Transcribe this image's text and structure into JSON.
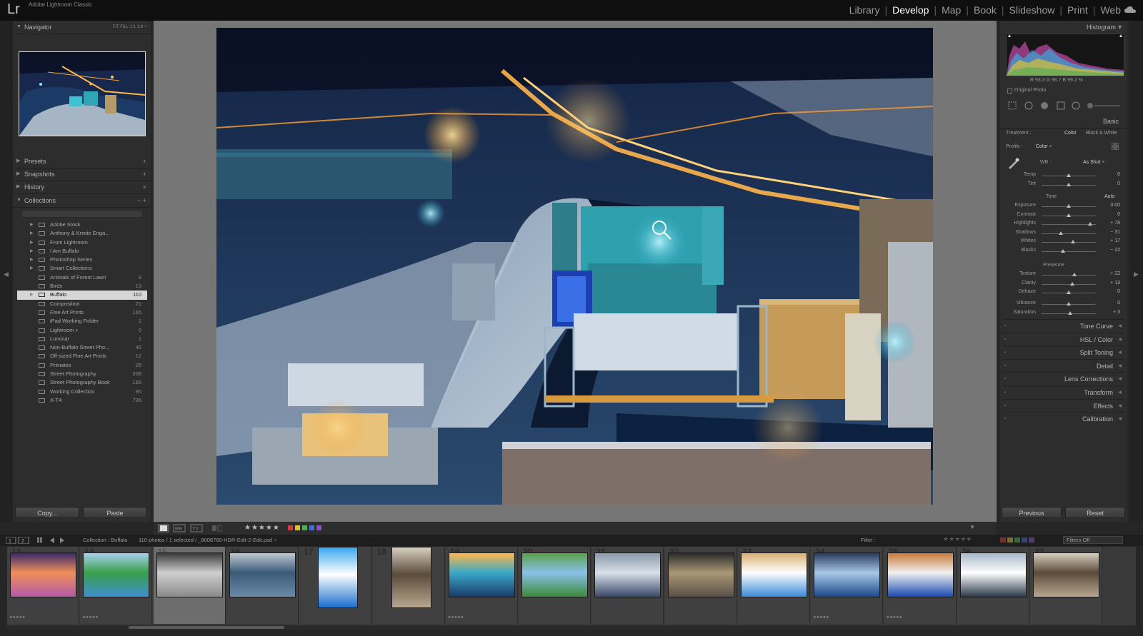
{
  "app": {
    "logo": "Lr",
    "title": "Adobe Lightroom Classic"
  },
  "modules": [
    {
      "label": "Library",
      "active": false
    },
    {
      "label": "Develop",
      "active": true
    },
    {
      "label": "Map",
      "active": false
    },
    {
      "label": "Book",
      "active": false
    },
    {
      "label": "Slideshow",
      "active": false
    },
    {
      "label": "Print",
      "active": false
    },
    {
      "label": "Web",
      "active": false
    }
  ],
  "left_panel": {
    "navigator": {
      "label": "Navigator",
      "controls": "FIT  FILL  1:1  1:8 ÷"
    },
    "presets": {
      "label": "Presets",
      "action": "+"
    },
    "snapshots": {
      "label": "Snapshots",
      "action": "+"
    },
    "history": {
      "label": "History",
      "action": "×"
    },
    "collections": {
      "label": "Collections",
      "action": "−  +"
    },
    "collection_items": [
      {
        "label": "Adobe Stock",
        "count": "",
        "set": true
      },
      {
        "label": "Anthony & Kristie Enga...",
        "count": "",
        "set": true
      },
      {
        "label": "From Lightroom",
        "count": "",
        "set": true
      },
      {
        "label": "I Am Buffalo",
        "count": "",
        "set": true
      },
      {
        "label": "Photoshop Series",
        "count": "",
        "set": true
      },
      {
        "label": "Smart Collections",
        "count": "",
        "set": true
      },
      {
        "label": "Animals of Forest Lawn",
        "count": "9",
        "set": false
      },
      {
        "label": "Birds",
        "count": "13",
        "set": false
      },
      {
        "label": "Buffalo",
        "count": "110",
        "set": true,
        "selected": true
      },
      {
        "label": "Composition",
        "count": "21",
        "set": false
      },
      {
        "label": "Fine Art Prints",
        "count": "165",
        "set": false
      },
      {
        "label": "iPad Working Folder",
        "count": "1",
        "set": false
      },
      {
        "label": "Lightroom +",
        "count": "0",
        "set": false
      },
      {
        "label": "Luminar",
        "count": "1",
        "set": false
      },
      {
        "label": "Non-Buffalo Street Pho...",
        "count": "46",
        "set": false
      },
      {
        "label": "Off-sized Fine Art Prints",
        "count": "12",
        "set": false
      },
      {
        "label": "Primates",
        "count": "26",
        "set": false
      },
      {
        "label": "Street Photography",
        "count": "208",
        "set": false
      },
      {
        "label": "Street Photography Book",
        "count": "165",
        "set": false
      },
      {
        "label": "Working Collection",
        "count": "95",
        "set": false
      },
      {
        "label": "X-T4",
        "count": "735",
        "set": false
      }
    ],
    "copy_button": "Copy...",
    "paste_button": "Paste"
  },
  "toolbar": {
    "stars": "★★★★★",
    "color_labels": [
      "#d33b3b",
      "#d9c237",
      "#4fae4f",
      "#3f6fd0",
      "#8a4fc9"
    ]
  },
  "right_panel": {
    "histogram": {
      "label": "Histogram",
      "rgb": "R  93.3   G  96.7   B  99.2  %",
      "original_photo": "Original Photo"
    },
    "basic": {
      "label": "Basic"
    },
    "treatment": {
      "label": "Treatment :",
      "color": "Color",
      "bw": "Black & White"
    },
    "profile": {
      "label": "Profile :",
      "value": "Color ÷"
    },
    "wb": {
      "label": "WB :",
      "value": "As Shot ÷"
    },
    "wb_sliders": [
      {
        "label": "Temp",
        "value": "0",
        "level": 0.5
      },
      {
        "label": "Tint",
        "value": "0",
        "level": 0.5
      }
    ],
    "tone": {
      "label": "Tone",
      "auto": "Auto"
    },
    "tone_sliders": [
      {
        "label": "Exposure",
        "value": "0.00",
        "level": 0.5
      },
      {
        "label": "Contrast",
        "value": "0",
        "level": 0.5
      },
      {
        "label": "Highlights",
        "value": "+ 78",
        "level": 0.89
      },
      {
        "label": "Shadows",
        "value": "− 31",
        "level": 0.35
      },
      {
        "label": "Whites",
        "value": "+ 17",
        "level": 0.58
      },
      {
        "label": "Blacks",
        "value": "− 22",
        "level": 0.39
      }
    ],
    "presence": {
      "label": "Presence"
    },
    "presence_sliders": [
      {
        "label": "Texture",
        "value": "+ 22",
        "level": 0.61
      },
      {
        "label": "Clarity",
        "value": "+ 13",
        "level": 0.56
      },
      {
        "label": "Dehaze",
        "value": "0",
        "level": 0.5
      },
      {
        "label": "Vibrance",
        "value": "0",
        "level": 0.5
      },
      {
        "label": "Saturation",
        "value": "+ 3",
        "level": 0.52
      }
    ],
    "sections": [
      "Tone Curve",
      "HSL / Color",
      "Split Toning",
      "Detail",
      "Lens Corrections",
      "Transform",
      "Effects",
      "Calibration"
    ],
    "previous_button": "Previous",
    "reset_button": "Reset"
  },
  "filmbar": {
    "collection": "Collection : Buffalo",
    "info": "110 photos / 1 selected / _8008780-HDR-Edit-2-Edit.psd ÷",
    "filter_label": "Filter :",
    "filter_value": "Filters Off"
  },
  "filmstrip": [
    {
      "num": "13",
      "stars": "★★★★★"
    },
    {
      "num": "14",
      "stars": "★★★★★"
    },
    {
      "num": "15",
      "stars": ""
    },
    {
      "num": "16",
      "stars": ""
    },
    {
      "num": "17",
      "stars": ""
    },
    {
      "num": "18",
      "stars": ""
    },
    {
      "num": "19",
      "stars": "★★★★★"
    },
    {
      "num": "20",
      "stars": ""
    },
    {
      "num": "21",
      "stars": ""
    },
    {
      "num": "22",
      "stars": ""
    },
    {
      "num": "23",
      "stars": ""
    },
    {
      "num": "24",
      "stars": "★★★★★"
    },
    {
      "num": "25",
      "stars": "★★★★★"
    },
    {
      "num": "26",
      "stars": ""
    },
    {
      "num": "27",
      "stars": ""
    }
  ]
}
